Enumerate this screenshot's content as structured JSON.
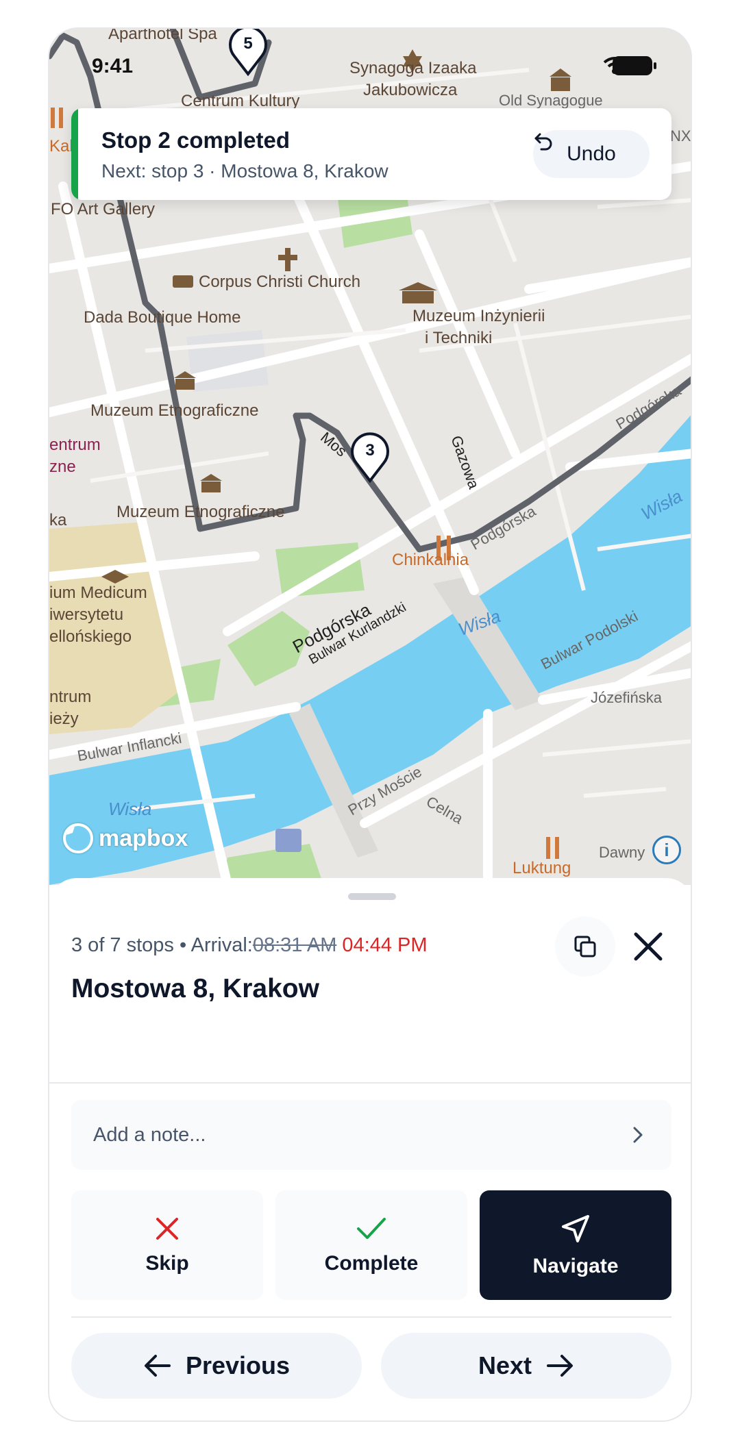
{
  "status_bar": {
    "time": "9:41"
  },
  "toast": {
    "title": "Stop 2 completed",
    "subtitle": "Next: stop 3 · Mostowa 8, Krakow",
    "undo_label": "Undo",
    "accent": "#16a34a"
  },
  "map": {
    "labels": {
      "aparthotel": "Aparthotel Spa",
      "synagoga1": "Synagoga Izaaka",
      "synagoga2": "Jakubowicza",
      "old_synagogue": "Old Synagogue",
      "centrum_kultury": "Centrum Kultury",
      "art_gallery": "FO Art Gallery",
      "corpus": "Corpus Christi Church",
      "dada": "Dada Boutique Home",
      "muzeum_inz1": "Muzeum Inżynierii",
      "muzeum_inz2": "i Techniki",
      "etno1": "Muzeum Etnograficzne",
      "etno2": "Muzeum Etnograficzne",
      "centrum1": "entrum",
      "centrum2": "zne",
      "ka": "ka",
      "medicum1": "ium Medicum",
      "medicum2": "iwersytetu",
      "medicum3": "ellońskiego",
      "centrum3": "ntrum",
      "centrum4": "ieży",
      "chinkalnia": "Chinkalnia",
      "podgorska1": "Podgórska",
      "podgorska2": "Podgórska",
      "podgorska3": "Podgórska",
      "kurlandzki": "Bulwar Kurlandzki",
      "inflancki": "Bulwar Inflancki",
      "podolski": "Bulwar Podolski",
      "jozefinska": "Józefińska",
      "przy_moscie": "Przy Moście",
      "celna": "Celna",
      "gazowa": "Gazowa",
      "mos": "Mos",
      "wisla1": "Wisła",
      "wisla2": "Wisła",
      "wisla3": "Wisła",
      "luktung": "Luktung",
      "dawny": "Dawny",
      "kab": "Kab",
      "nx": "NX"
    },
    "markers": {
      "stop5": "5",
      "stop3": "3"
    },
    "attribution": "mapbox",
    "info_icon": "i"
  },
  "sheet": {
    "meta_prefix": "3 of 7 stops • Arrival:",
    "arrival_old": "08:31 AM",
    "arrival_new": "04:44 PM",
    "address": "Mostowa 8, Krakow",
    "note_placeholder": "Add a note...",
    "actions": {
      "skip": "Skip",
      "complete": "Complete",
      "navigate": "Navigate"
    },
    "pager": {
      "previous": "Previous",
      "next": "Next"
    },
    "colors": {
      "late": "#dc2626",
      "skip": "#dc2626",
      "complete": "#16a34a",
      "navigate_bg": "#0f172a"
    }
  }
}
